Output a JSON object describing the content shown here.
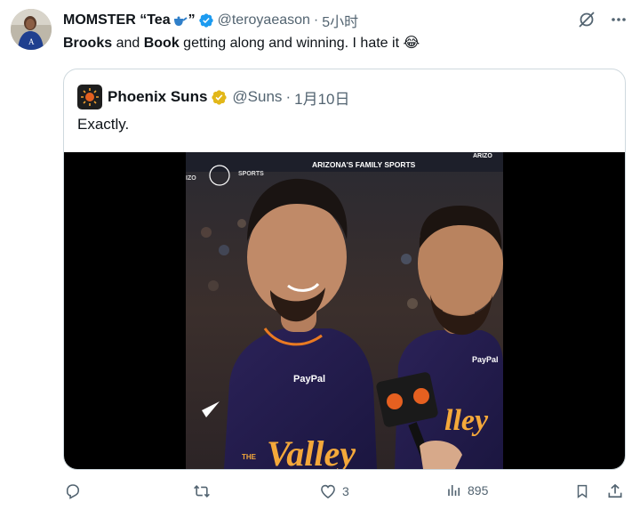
{
  "author": {
    "display_name": "MOMSTER “Tea",
    "display_name_suffix": "”",
    "handle": "@teroyaeason",
    "separator": "·",
    "time": "5小时"
  },
  "tweet": {
    "segments": [
      "Brooks",
      " and ",
      "Book",
      " getting along and winning. I hate it "
    ],
    "emoji": "😂"
  },
  "quoted": {
    "display_name": "Phoenix Suns",
    "handle": "@Suns",
    "separator": "·",
    "time": "1月10日",
    "text": "Exactly."
  },
  "media_labels": {
    "banner": "ARIZONA'S FAMILY SPORTS",
    "arizona": "ARIZO",
    "corner": "IZO",
    "corner_sports": "SPORTS",
    "jersey_left": "PayPal",
    "jersey_right": "PayPal",
    "jersey_script_left": "Valley",
    "jersey_script_right": "lley",
    "jersey_small": "THE"
  },
  "actions": {
    "reply_count": "",
    "retweet_count": "",
    "like_count": "3",
    "views_count": "895"
  },
  "colors": {
    "verified_blue": "#1d9bf0",
    "verified_gold": "#e2b719",
    "text_primary": "#0f1419",
    "text_secondary": "#536471",
    "border": "#cfd9de"
  },
  "icons": [
    "verified-badge-icon",
    "grok-icon",
    "more-icon",
    "reply-icon",
    "retweet-icon",
    "like-icon",
    "views-icon",
    "bookmark-icon",
    "share-icon"
  ]
}
